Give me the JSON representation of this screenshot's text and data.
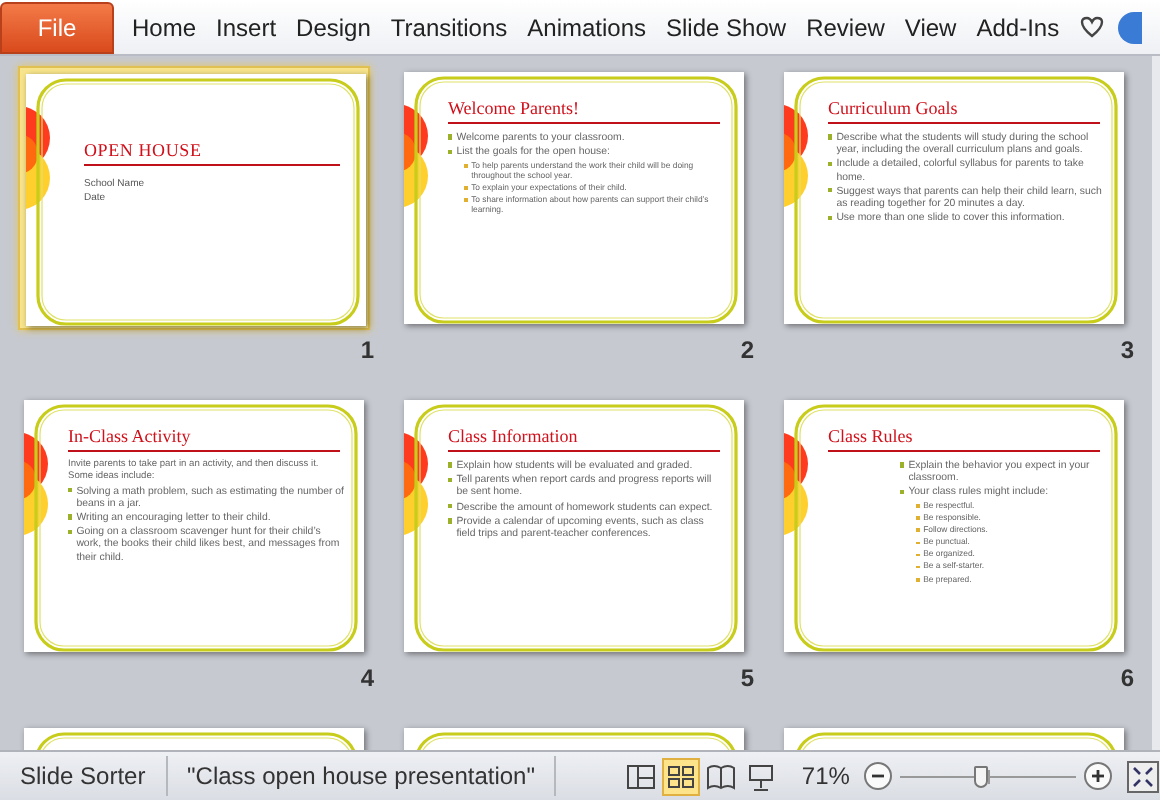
{
  "ribbon": {
    "file_tab": "File",
    "tabs": [
      {
        "label": "Home",
        "selected": false
      },
      {
        "label": "Insert",
        "selected": false
      },
      {
        "label": "Design",
        "selected": false
      },
      {
        "label": "Transitions",
        "selected": false
      },
      {
        "label": "Animations",
        "selected": false
      },
      {
        "label": "Slide Show",
        "selected": false
      },
      {
        "label": "Review",
        "selected": false
      },
      {
        "label": "View",
        "selected": false
      },
      {
        "label": "Add-Ins",
        "selected": false
      }
    ]
  },
  "slides": [
    {
      "kind": "title",
      "number": "1",
      "selected": true,
      "title": "OPEN HOUSE",
      "lines": [
        "School Name",
        "Date"
      ]
    },
    {
      "kind": "content",
      "number": "2",
      "selected": false,
      "title": "Welcome Parents!",
      "body": [
        {
          "kind": "bullet",
          "text": "Welcome parents to your classroom."
        },
        {
          "kind": "bullet",
          "text": "List the goals for the open house:",
          "children": [
            {
              "kind": "bullet",
              "text": "To help parents understand the work their child will be doing throughout the school year."
            },
            {
              "kind": "bullet",
              "text": "To explain your expectations of their child."
            },
            {
              "kind": "bullet",
              "text": "To share information about how parents can support their child’s learning."
            }
          ]
        }
      ]
    },
    {
      "kind": "content",
      "number": "3",
      "selected": false,
      "title": "Curriculum Goals",
      "body": [
        {
          "kind": "bullet",
          "text": "Describe what the students will study during the school year, including the overall curriculum plans and goals."
        },
        {
          "kind": "bullet",
          "text": "Include a detailed, colorful syllabus for parents to take home."
        },
        {
          "kind": "bullet",
          "text": "Suggest ways that parents can help their child learn, such as reading together for 20 minutes a day."
        },
        {
          "kind": "bullet",
          "text": "Use more than one slide to cover this information."
        }
      ]
    },
    {
      "kind": "content",
      "number": "4",
      "selected": false,
      "title": "In-Class Activity",
      "body": [
        {
          "kind": "paragraph",
          "text": "Invite parents to take part in an activity, and then discuss it. Some ideas include:"
        },
        {
          "kind": "bullet",
          "text": "Solving a math problem, such as estimating the number of beans in a jar."
        },
        {
          "kind": "bullet",
          "text": "Writing an encouraging letter to their child."
        },
        {
          "kind": "bullet",
          "text": "Going on a classroom scavenger hunt for their child’s work, the books their child likes best, and messages from their child."
        }
      ]
    },
    {
      "kind": "content",
      "number": "5",
      "selected": false,
      "title": "Class Information",
      "body": [
        {
          "kind": "bullet",
          "text": "Explain how students will be evaluated and graded."
        },
        {
          "kind": "bullet",
          "text": "Tell parents when report cards and progress reports will be sent home."
        },
        {
          "kind": "bullet",
          "text": "Describe the amount of homework students can expect."
        },
        {
          "kind": "bullet",
          "text": "Provide a calendar of upcoming events, such as class field trips and parent-teacher conferences."
        }
      ]
    },
    {
      "kind": "indented",
      "number": "6",
      "selected": false,
      "title": "Class Rules",
      "body": [
        {
          "kind": "bullet",
          "text": "Explain the behavior you expect in your classroom."
        },
        {
          "kind": "bullet",
          "text": "Your class rules might include:",
          "children": [
            {
              "kind": "bullet",
              "text": "Be respectful."
            },
            {
              "kind": "bullet",
              "text": "Be responsible."
            },
            {
              "kind": "bullet",
              "text": "Follow directions."
            },
            {
              "kind": "bullet",
              "text": "Be punctual."
            },
            {
              "kind": "bullet",
              "text": "Be organized."
            },
            {
              "kind": "bullet",
              "text": "Be a self-starter."
            },
            {
              "kind": "bullet",
              "text": "Be prepared."
            }
          ]
        }
      ]
    },
    {
      "kind": "partial",
      "selected": false
    },
    {
      "kind": "partial",
      "selected": false
    },
    {
      "kind": "partial",
      "selected": false
    }
  ],
  "status_bar": {
    "view_name": "Slide Sorter",
    "file_name": "\"Class open house presentation\"",
    "views": [
      {
        "kind": "normal",
        "selected": false
      },
      {
        "kind": "sorter",
        "selected": true
      },
      {
        "kind": "reading",
        "selected": false
      },
      {
        "kind": "slideshow",
        "selected": false
      }
    ],
    "zoom": "71%",
    "zoom_slider": {
      "level": 0.46
    }
  }
}
